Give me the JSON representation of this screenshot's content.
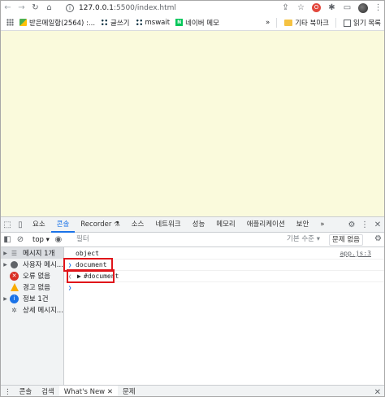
{
  "browser": {
    "url_host": "127.0.0.1",
    "url_rest": ":5500/index.html",
    "icons": [
      "back-icon",
      "forward-icon",
      "reload-icon",
      "home-icon",
      "share-icon",
      "bookmark-star-icon",
      "extension-red-icon",
      "puzzle-icon",
      "tab-search-icon",
      "profile-avatar",
      "more-icon"
    ]
  },
  "bookmarks": {
    "items": [
      {
        "label": "받은메일함(2564) :..."
      },
      {
        "label": "글쓰기"
      },
      {
        "label": "mswait"
      },
      {
        "label": "네이버 메모"
      }
    ],
    "overflow": "»",
    "folder": "기타 북마크",
    "reading_list": "읽기 목록"
  },
  "devtools": {
    "tabs": [
      "요소",
      "콘솔",
      "Recorder",
      "소스",
      "네트워크",
      "성능",
      "메모리",
      "애플리케이션",
      "보안"
    ],
    "overflow": "»",
    "active_tab": 1,
    "context": "top",
    "filter_placeholder": "필터",
    "level": "기본 수준",
    "issues_button": "문제 없음",
    "sidebar": [
      {
        "label": "메시지 1개",
        "icon": "list-icon"
      },
      {
        "label": "사용자 메시...",
        "icon": "user-icon"
      },
      {
        "label": "오류 없음",
        "icon": "error-icon"
      },
      {
        "label": "경고 없음",
        "icon": "warning-icon"
      },
      {
        "label": "정보 1건",
        "icon": "info-icon"
      },
      {
        "label": "상세 메시지...",
        "icon": "bug-icon"
      }
    ],
    "console": {
      "log_text": "object",
      "log_source": "app.js:3",
      "input_text": "document",
      "result_text": "#document"
    },
    "drawer_tabs": [
      "콘솔",
      "검색",
      "What's New",
      "문제"
    ]
  }
}
